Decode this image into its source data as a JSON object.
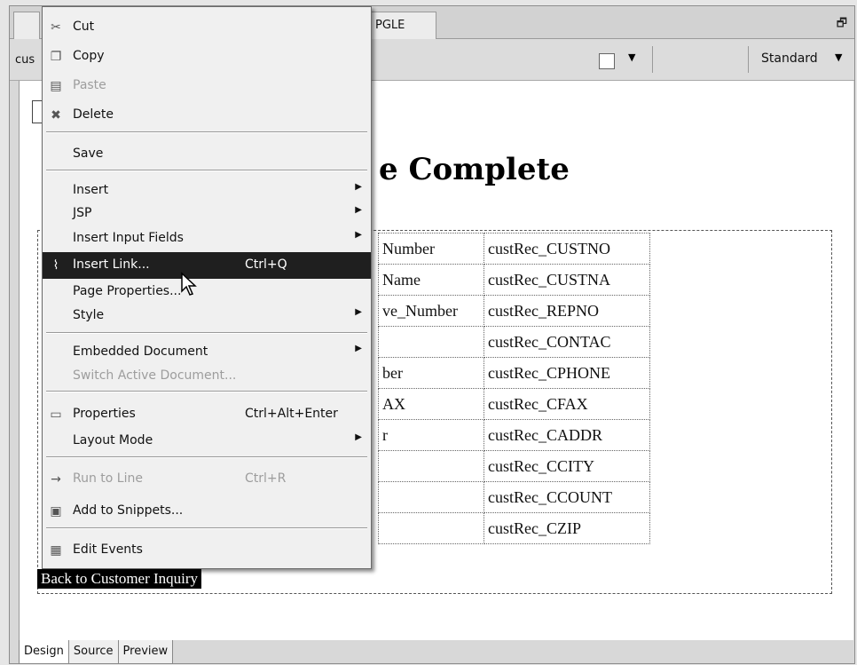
{
  "tabs": {
    "left_tab_label": "",
    "right_tab_label": "PGLE"
  },
  "toolbar": {
    "left_label": "cus",
    "view_select": "Standard"
  },
  "page": {
    "heading": "e Complete",
    "fields": [
      {
        "label": "Number",
        "value": "custRec_CUSTNO"
      },
      {
        "label": "Name",
        "value": "custRec_CUSTNA"
      },
      {
        "label": "ve_Number",
        "value": "custRec_REPNO"
      },
      {
        "label": "",
        "value": "custRec_CONTAC"
      },
      {
        "label": "ber",
        "value": "custRec_CPHONE"
      },
      {
        "label": "AX",
        "value": "custRec_CFAX"
      },
      {
        "label": "r",
        "value": "custRec_CADDR"
      },
      {
        "label": "",
        "value": "custRec_CCITY"
      },
      {
        "label": "",
        "value": "custRec_CCOUNT"
      },
      {
        "label": "",
        "value": "custRec_CZIP"
      }
    ],
    "back_link": "Back to Customer Inquiry"
  },
  "bottom_tabs": [
    "Design",
    "Source",
    "Preview"
  ],
  "context_menu": {
    "items": [
      {
        "label": "Cut",
        "shortcut": "",
        "icon": "scissors-icon",
        "disabled": false,
        "submenu": false
      },
      {
        "label": "Copy",
        "shortcut": "",
        "icon": "copy-icon",
        "disabled": false,
        "submenu": false
      },
      {
        "label": "Paste",
        "shortcut": "",
        "icon": "paste-icon",
        "disabled": true,
        "submenu": false
      },
      {
        "label": "Delete",
        "shortcut": "",
        "icon": "delete-icon",
        "disabled": false,
        "submenu": false
      },
      {
        "label": "Save",
        "shortcut": "",
        "icon": "",
        "disabled": false,
        "submenu": false
      },
      {
        "label": "Insert",
        "shortcut": "",
        "icon": "",
        "disabled": false,
        "submenu": true
      },
      {
        "label": "JSP",
        "shortcut": "",
        "icon": "",
        "disabled": false,
        "submenu": true
      },
      {
        "label": "Insert Input Fields",
        "shortcut": "",
        "icon": "",
        "disabled": false,
        "submenu": true
      },
      {
        "label": "Insert Link...",
        "shortcut": "Ctrl+Q",
        "icon": "link-icon",
        "disabled": false,
        "submenu": false,
        "highlighted": true
      },
      {
        "label": "Page Properties...",
        "shortcut": "",
        "icon": "",
        "disabled": false,
        "submenu": false
      },
      {
        "label": "Style",
        "shortcut": "",
        "icon": "",
        "disabled": false,
        "submenu": true
      },
      {
        "label": "Embedded Document",
        "shortcut": "",
        "icon": "",
        "disabled": false,
        "submenu": true
      },
      {
        "label": "Switch Active Document...",
        "shortcut": "",
        "icon": "",
        "disabled": true,
        "submenu": false
      },
      {
        "label": "Properties",
        "shortcut": "Ctrl+Alt+Enter",
        "icon": "properties-icon",
        "disabled": false,
        "submenu": false
      },
      {
        "label": "Layout Mode",
        "shortcut": "",
        "icon": "",
        "disabled": false,
        "submenu": true
      },
      {
        "label": "Run to Line",
        "shortcut": "Ctrl+R",
        "icon": "run-to-line-icon",
        "disabled": true,
        "submenu": false
      },
      {
        "label": "Add to Snippets...",
        "shortcut": "",
        "icon": "snippets-icon",
        "disabled": false,
        "submenu": false
      },
      {
        "label": "Edit Events",
        "shortcut": "",
        "icon": "edit-events-icon",
        "disabled": false,
        "submenu": false
      }
    ]
  }
}
